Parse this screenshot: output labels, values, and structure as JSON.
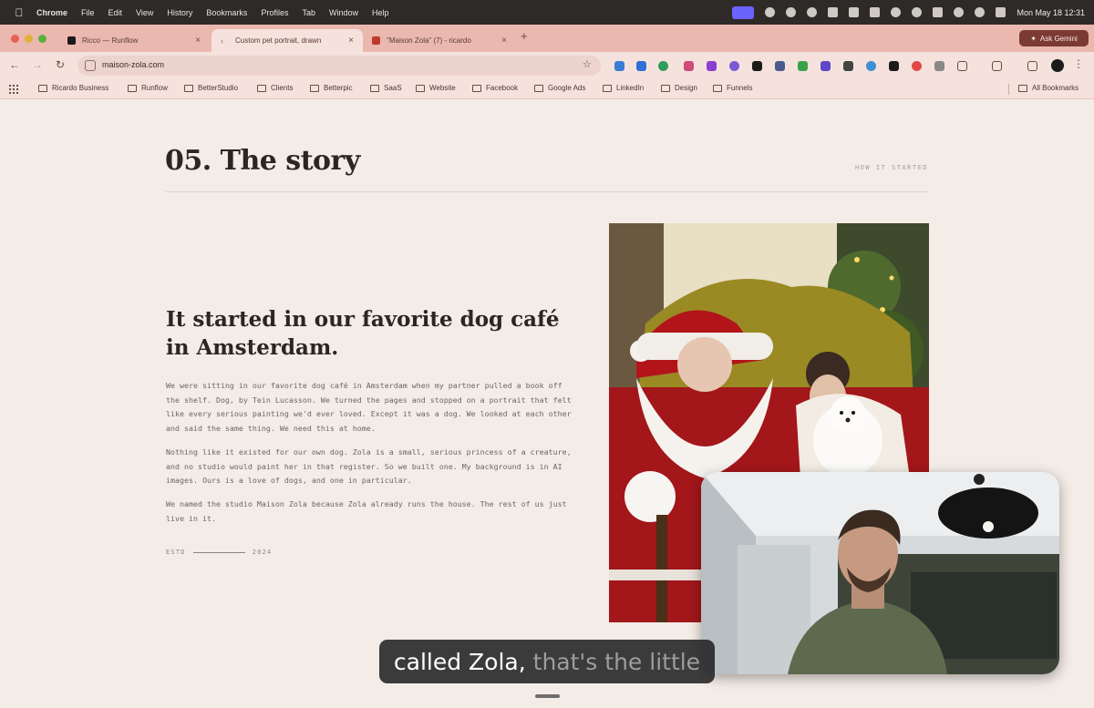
{
  "menubar": {
    "app_name": "Chrome",
    "menus": [
      "File",
      "Edit",
      "View",
      "History",
      "Bookmarks",
      "Profiles",
      "Tab",
      "Window",
      "Help"
    ],
    "clock": "Mon May 18  12:31"
  },
  "tabs": [
    {
      "title": "Ricco — Runflow",
      "favicon_color": "#1b1b1b"
    },
    {
      "title": "Custom pet portrait, drawn",
      "favicon_color": "#8a6e69"
    },
    {
      "title": "\"Maison Zola\" (7) - ricardo",
      "favicon_color": "#c0392b"
    }
  ],
  "gemini_label": "Ask Gemini",
  "address_bar": {
    "url": "maison-zola.com"
  },
  "bookmarks": [
    "Ricardo Business",
    "Runflow",
    "BetterStudio",
    "Clients",
    "Betterpic",
    "SaaS",
    "Website",
    "Facebook",
    "Google Ads",
    "LinkedIn",
    "Design",
    "Funnels"
  ],
  "all_bookmarks": "All Bookmarks",
  "page": {
    "section_title": "05. The story",
    "kicker": "HOW IT STARTED",
    "headline": "It started in our favorite dog café in Amsterdam.",
    "paragraphs": [
      "We were sitting in our favorite dog café in Amsterdam when my partner pulled a book off the shelf. Dog, by Tein Lucasson. We turned the pages and stopped on a portrait that felt like every serious painting we'd ever loved. Except it was a dog. We looked at each other and said the same thing. We need this at home.",
      "Nothing like it existed for our own dog. Zola is a small, serious princess of a creature, and no studio would paint her in that register. So we built one. My background is in AI images. Ours is a love of dogs, and one in particular.",
      "We named the studio Maison Zola because Zola already runs the house. The rest of us just live in it."
    ],
    "estd_left": "ESTD",
    "estd_right": "2024"
  },
  "caption": {
    "spoken": "called Zola,",
    "upcoming": "that's the little"
  },
  "colors": {
    "page_bg": "#f4ece6",
    "tabstrip": "#eab8ae",
    "toolbar": "#f6e2dd",
    "heading": "#2b2523",
    "body_text": "#6e6560"
  }
}
